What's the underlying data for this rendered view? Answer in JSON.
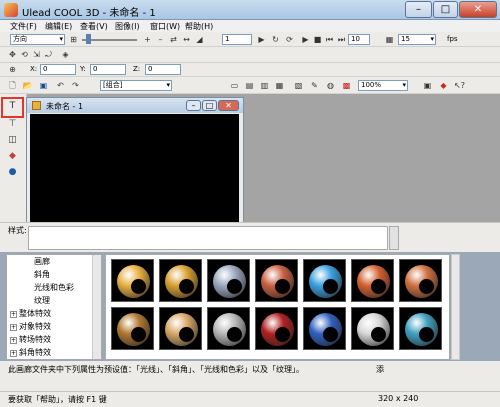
{
  "window": {
    "title": "Ulead COOL 3D - 未命名 - 1"
  },
  "menu": [
    "文件(F)",
    "编辑(E)",
    "查看(V)",
    "图像(I)",
    "窗口(W)",
    "帮助(H)"
  ],
  "toolbar1": {
    "direction_value": "方向",
    "frame_value": "1",
    "total_frames": "10",
    "fps_value": "15",
    "fps_label": "fps"
  },
  "toolbar2": {
    "x_label": "X:",
    "x_value": "0",
    "y_label": "Y:",
    "y_value": "0",
    "z_label": "Z:",
    "z_value": "0"
  },
  "toolbar4": {
    "group_value": "[组合]",
    "zoom_value": "100%"
  },
  "document": {
    "title": "未命名 - 1"
  },
  "style_label": "样式:",
  "tree": {
    "items": [
      {
        "label": "画廊",
        "expand": "",
        "indent": 2
      },
      {
        "label": "斜角",
        "expand": "",
        "indent": 2
      },
      {
        "label": "光线和色彩",
        "expand": "",
        "indent": 2
      },
      {
        "label": "纹理",
        "expand": "",
        "indent": 2
      },
      {
        "label": "整体特效",
        "expand": "+",
        "indent": 0
      },
      {
        "label": "对象特效",
        "expand": "+",
        "indent": 0
      },
      {
        "label": "转场特效",
        "expand": "+",
        "indent": 0
      },
      {
        "label": "斜角特效",
        "expand": "+",
        "indent": 0
      }
    ]
  },
  "thumbs": {
    "colors": [
      "#e8b040",
      "#d8a030",
      "#9ca8c0",
      "#c86040",
      "#3aa0e0",
      "#d46030",
      "#d07040",
      "#b07830",
      "#d8a868",
      "#b8b8b8",
      "#b02020",
      "#3060c0",
      "#d8d8d8",
      "#40a0c0"
    ]
  },
  "description": "此画廊文件夹中下列属性为预设值：「光线」、「斜角」、「光线和色彩」以及「纹理」。",
  "side_label": "添",
  "status": {
    "help_text": "要获取「帮助」，请按 F1 键",
    "size_text": "320 x 240"
  }
}
